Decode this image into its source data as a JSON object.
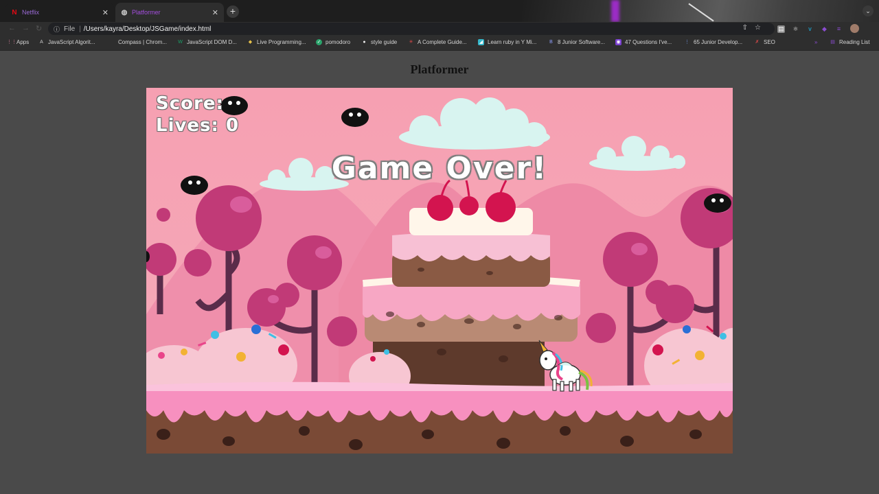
{
  "browser": {
    "tabs": [
      {
        "title": "Netflix",
        "icon": "netflix-icon"
      },
      {
        "title": "Platformer",
        "icon": "globe-icon"
      }
    ],
    "new_tab": "+",
    "address": {
      "scheme": "File",
      "url": "/Users/kayra/Desktop/JSGame/index.html"
    },
    "bookmarks": [
      "Apps",
      "JavaScript Algorit...",
      "Compass | Chrom...",
      "JavaScript DOM D...",
      "Live Programming...",
      "pomodoro",
      "style guide",
      "A Complete Guide...",
      "Learn ruby in Y Mi...",
      "8 Junior Software...",
      "47 Questions I've...",
      "65 Junior Develop...",
      "SEO"
    ],
    "more": "»",
    "reading_list": "Reading List"
  },
  "page": {
    "title": "Platformer"
  },
  "game": {
    "score_label": "Score: ",
    "lives_label": "Lives: 0",
    "game_over": "Game Over!",
    "colors": {
      "sky": "#f6a0b2",
      "hills": "#ef8aa6",
      "trees": "#c23a78",
      "cream": "#fff3e6",
      "frosting": "#f790bf",
      "chocolate": "#7a4a36",
      "cloud": "#d8f4f0"
    }
  }
}
